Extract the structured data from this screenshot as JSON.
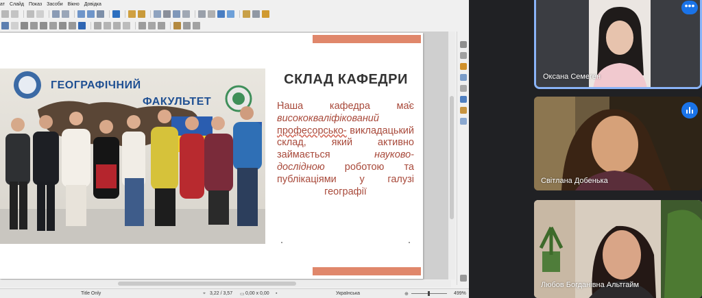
{
  "menubar": {
    "items": [
      "ат",
      "Слайд",
      "Показ",
      "Засоби",
      "Вікно",
      "Довідка"
    ]
  },
  "slide": {
    "title": "СКЛАД КАФЕДРИ",
    "body": {
      "line1": "Наша кафедра має",
      "highlight1": "висококваліфікований",
      "highlight2": "професорсько-",
      "line2": "викладацький склад, який активно займається",
      "highlight3": "науково-дослідною",
      "line3": "роботою та публікаціями у галузі географії"
    },
    "photo_banner": {
      "left": "ГЕОГРАФІЧНИЙ",
      "right": "ФАКУЛЬТЕТ"
    },
    "accent_color": "#e0876b",
    "body_color": "#a8493a"
  },
  "statusbar": {
    "layout": "Title Only",
    "position": "3,22 / 3,57",
    "size": "0,00 x 0,00",
    "language": "Українська",
    "zoom": "499%"
  },
  "participants": [
    {
      "name": "Оксана Семеген"
    },
    {
      "name": "Світлана Добенька"
    },
    {
      "name": "Любов Богданівна Альтгайм"
    }
  ],
  "meet": {
    "more_label": "•••",
    "active_color": "#8ab4f8"
  }
}
